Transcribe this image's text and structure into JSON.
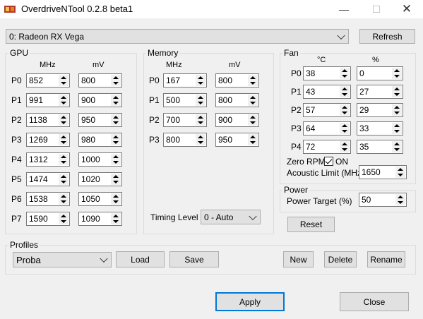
{
  "window": {
    "title": "OverdriveNTool 0.2.8 beta1"
  },
  "device": {
    "selected": "0: Radeon RX Vega",
    "refresh_label": "Refresh"
  },
  "gpu": {
    "label": "GPU",
    "col_mhz": "MHz",
    "col_mv": "mV",
    "rows": [
      {
        "p": "P0",
        "mhz": "852",
        "mv": "800"
      },
      {
        "p": "P1",
        "mhz": "991",
        "mv": "900"
      },
      {
        "p": "P2",
        "mhz": "1138",
        "mv": "950"
      },
      {
        "p": "P3",
        "mhz": "1269",
        "mv": "980"
      },
      {
        "p": "P4",
        "mhz": "1312",
        "mv": "1000"
      },
      {
        "p": "P5",
        "mhz": "1474",
        "mv": "1020"
      },
      {
        "p": "P6",
        "mhz": "1538",
        "mv": "1050"
      },
      {
        "p": "P7",
        "mhz": "1590",
        "mv": "1090"
      }
    ]
  },
  "memory": {
    "label": "Memory",
    "col_mhz": "MHz",
    "col_mv": "mV",
    "rows": [
      {
        "p": "P0",
        "mhz": "167",
        "mv": "800"
      },
      {
        "p": "P1",
        "mhz": "500",
        "mv": "800"
      },
      {
        "p": "P2",
        "mhz": "700",
        "mv": "900"
      },
      {
        "p": "P3",
        "mhz": "800",
        "mv": "950"
      }
    ],
    "timing_label": "Timing Level",
    "timing_value": "0 - Auto"
  },
  "fan": {
    "label": "Fan",
    "col_c": "°C",
    "col_pct": "%",
    "rows": [
      {
        "p": "P0",
        "c": "38",
        "pct": "0"
      },
      {
        "p": "P1",
        "c": "43",
        "pct": "27"
      },
      {
        "p": "P2",
        "c": "57",
        "pct": "29"
      },
      {
        "p": "P3",
        "c": "64",
        "pct": "33"
      },
      {
        "p": "P4",
        "c": "72",
        "pct": "35"
      }
    ],
    "zero_rpm_label": "Zero RPM",
    "zero_rpm_on": "ON",
    "acoustic_label": "Acoustic Limit (MHz)",
    "acoustic_value": "1650"
  },
  "power": {
    "label": "Power",
    "target_label": "Power Target (%)",
    "target_value": "50"
  },
  "reset_label": "Reset",
  "profiles": {
    "label": "Profiles",
    "selected": "Proba",
    "load": "Load",
    "save": "Save",
    "new": "New",
    "delete": "Delete",
    "rename": "Rename"
  },
  "footer": {
    "apply": "Apply",
    "close": "Close"
  }
}
